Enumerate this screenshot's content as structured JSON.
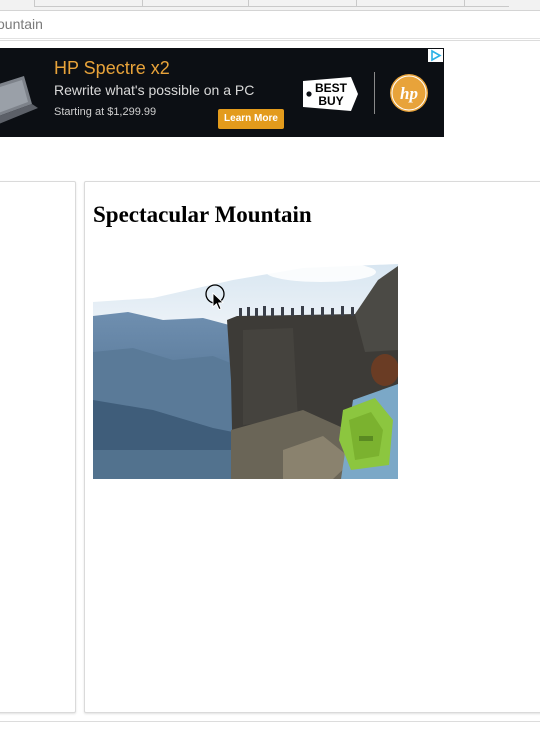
{
  "breadcrumb": {
    "text": "ountain"
  },
  "ad": {
    "title": "HP Spectre x2",
    "tagline": "Rewrite what's possible on a PC",
    "price_text": "Starting at $1,299.99",
    "cta_label": "Learn More",
    "retailer_logo_text": "BEST BUY",
    "brand_logo_text": "hp",
    "colors": {
      "background": "#0c0f14",
      "title": "#e8a33a",
      "cta": "#e39b1c",
      "retailer_yellow": "#fff200",
      "brand_blue": "#0096d6"
    }
  },
  "main": {
    "title": "Spectacular Mountain",
    "image_alt": "Hikers on a cliff overlooking a fjord"
  },
  "icons": {
    "ad_choices": "ad-choices-icon",
    "cursor": "loading-cursor-icon"
  }
}
